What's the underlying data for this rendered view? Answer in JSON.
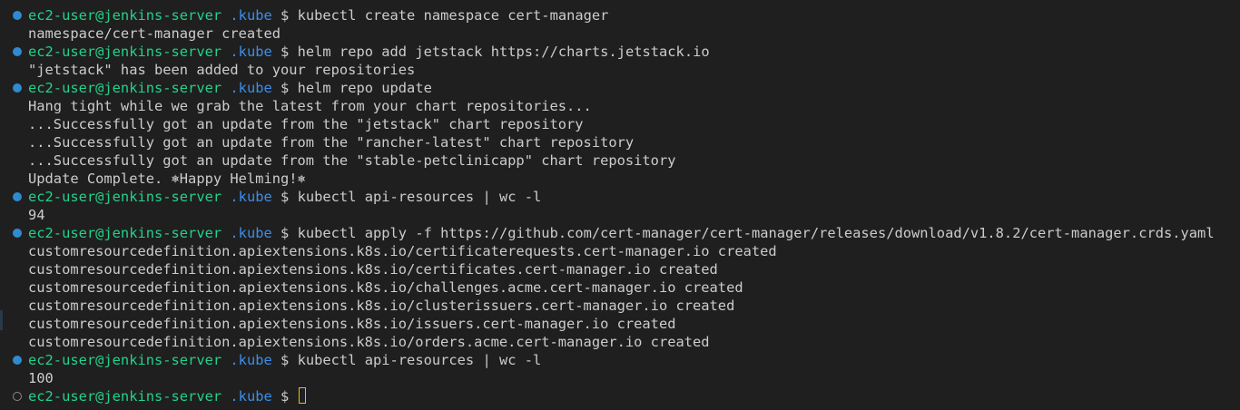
{
  "prompt": {
    "user_host": "ec2-user@jenkins-server",
    "dir": ".kube",
    "symbol": "$"
  },
  "lines": [
    {
      "kind": "cmd",
      "cmd": "kubectl create namespace cert-manager"
    },
    {
      "kind": "out",
      "text": "namespace/cert-manager created"
    },
    {
      "kind": "cmd",
      "cmd": "helm repo add jetstack https://charts.jetstack.io"
    },
    {
      "kind": "out",
      "text": "\"jetstack\" has been added to your repositories"
    },
    {
      "kind": "cmd",
      "cmd": "helm repo update"
    },
    {
      "kind": "out",
      "text": "Hang tight while we grab the latest from your chart repositories..."
    },
    {
      "kind": "out",
      "text": "...Successfully got an update from the \"jetstack\" chart repository"
    },
    {
      "kind": "out",
      "text": "...Successfully got an update from the \"rancher-latest\" chart repository"
    },
    {
      "kind": "out",
      "text": "...Successfully got an update from the \"stable-petclinicapp\" chart repository"
    },
    {
      "kind": "out",
      "text": "Update Complete. ⎈Happy Helming!⎈"
    },
    {
      "kind": "cmd",
      "cmd": "kubectl api-resources | wc -l"
    },
    {
      "kind": "out",
      "text": "94"
    },
    {
      "kind": "cmd",
      "cmd": "kubectl apply -f https://github.com/cert-manager/cert-manager/releases/download/v1.8.2/cert-manager.crds.yaml"
    },
    {
      "kind": "out",
      "text": "customresourcedefinition.apiextensions.k8s.io/certificaterequests.cert-manager.io created"
    },
    {
      "kind": "out",
      "text": "customresourcedefinition.apiextensions.k8s.io/certificates.cert-manager.io created"
    },
    {
      "kind": "out",
      "text": "customresourcedefinition.apiextensions.k8s.io/challenges.acme.cert-manager.io created"
    },
    {
      "kind": "out",
      "text": "customresourcedefinition.apiextensions.k8s.io/clusterissuers.cert-manager.io created"
    },
    {
      "kind": "out",
      "text": "customresourcedefinition.apiextensions.k8s.io/issuers.cert-manager.io created"
    },
    {
      "kind": "out",
      "text": "customresourcedefinition.apiextensions.k8s.io/orders.acme.cert-manager.io created"
    },
    {
      "kind": "cmd",
      "cmd": "kubectl api-resources | wc -l"
    },
    {
      "kind": "out",
      "text": "100"
    },
    {
      "kind": "active",
      "cmd": ""
    }
  ],
  "colors": {
    "background": "#1f1f1f",
    "user_host": "#23d18b",
    "directory": "#3b8eea",
    "text": "#cccccc",
    "decoration_success": "#2f8bd1",
    "cursor": "#e8c000"
  },
  "icons": {
    "command_success": "filled-circle-decoration-icon",
    "command_pending": "hollow-circle-decoration-icon"
  }
}
